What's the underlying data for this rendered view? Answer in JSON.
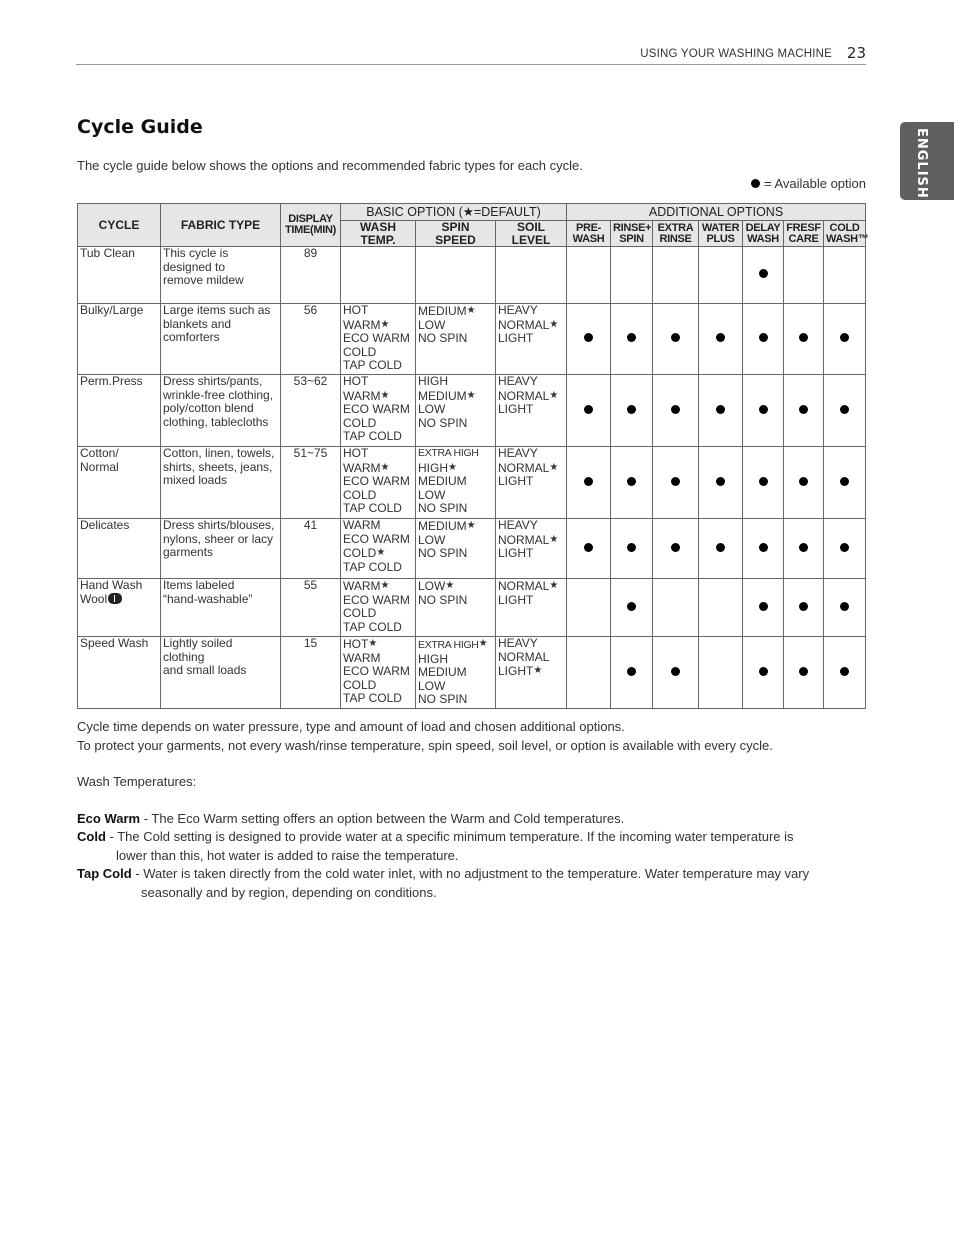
{
  "header": {
    "section": "USING YOUR WASHING MACHINE",
    "page_number": "23",
    "language_tab": "ENGLISH"
  },
  "title": "Cycle Guide",
  "intro": "The cycle guide below shows the options and recommended fabric types for each cycle.",
  "legend": {
    "icon": "filled-circle",
    "text": "= Available option"
  },
  "table": {
    "headers": {
      "cycle": "CYCLE",
      "fabric_type": "FABRIC TYPE",
      "display_time": [
        "DISPLAY",
        "TIME(MIN)"
      ],
      "basic_group": "BASIC OPTION (★=DEFAULT)",
      "basic": [
        [
          "WASH",
          "TEMP."
        ],
        [
          "SPIN",
          "SPEED"
        ],
        [
          "SOIL",
          "LEVEL"
        ]
      ],
      "additional_group": "ADDITIONAL OPTIONS",
      "additional": [
        [
          "PRE-",
          "WASH"
        ],
        [
          "RINSE+",
          "SPIN"
        ],
        [
          "EXTRA",
          "RINSE"
        ],
        [
          "WATER",
          "PLUS"
        ],
        [
          "DELAY",
          "WASH"
        ],
        [
          "FRESF",
          "CARE"
        ],
        [
          "COLD",
          "WASH™"
        ]
      ]
    },
    "default_marker": "★",
    "rows": [
      {
        "cycle": [
          "Tub Clean"
        ],
        "fabric": [
          "This cycle is",
          "designed to",
          "remove mildew"
        ],
        "time": "89",
        "wash_temp": [],
        "spin_speed": [],
        "soil_level": [],
        "options": [
          false,
          false,
          false,
          false,
          true,
          false,
          false
        ]
      },
      {
        "cycle": [
          "Bulky/Large"
        ],
        "fabric": [
          "Large items such as",
          "blankets and",
          "comforters"
        ],
        "time": "56",
        "wash_temp": [
          {
            "t": "HOT"
          },
          {
            "t": "WARM",
            "d": true
          },
          {
            "t": "ECO WARM"
          },
          {
            "t": "COLD"
          },
          {
            "t": "TAP COLD"
          }
        ],
        "spin_speed": [
          {
            "t": "MEDIUM",
            "d": true
          },
          {
            "t": "LOW"
          },
          {
            "t": "NO SPIN"
          }
        ],
        "soil_level": [
          {
            "t": "HEAVY"
          },
          {
            "t": "NORMAL",
            "d": true
          },
          {
            "t": "LIGHT"
          }
        ],
        "options": [
          true,
          true,
          true,
          true,
          true,
          true,
          true
        ]
      },
      {
        "cycle": [
          "Perm.Press"
        ],
        "fabric": [
          "Dress shirts/pants,",
          "wrinkle-free clothing,",
          "poly/cotton blend",
          "clothing, tablecloths"
        ],
        "time": "53~62",
        "wash_temp": [
          {
            "t": "HOT"
          },
          {
            "t": "WARM",
            "d": true
          },
          {
            "t": "ECO WARM"
          },
          {
            "t": "COLD"
          },
          {
            "t": "TAP COLD"
          }
        ],
        "spin_speed": [
          {
            "t": "HIGH"
          },
          {
            "t": "MEDIUM",
            "d": true
          },
          {
            "t": "LOW"
          },
          {
            "t": "NO SPIN"
          }
        ],
        "soil_level": [
          {
            "t": "HEAVY"
          },
          {
            "t": "NORMAL",
            "d": true
          },
          {
            "t": "LIGHT"
          }
        ],
        "options": [
          true,
          true,
          true,
          true,
          true,
          true,
          true
        ]
      },
      {
        "cycle": [
          "Cotton/",
          "Normal"
        ],
        "fabric": [
          "Cotton, linen, towels,",
          "shirts, sheets, jeans,",
          "mixed loads"
        ],
        "time": "51~75",
        "wash_temp": [
          {
            "t": "HOT"
          },
          {
            "t": "WARM",
            "d": true
          },
          {
            "t": "ECO WARM"
          },
          {
            "t": "COLD"
          },
          {
            "t": "TAP COLD"
          }
        ],
        "spin_speed": [
          {
            "t": "EXTRA HIGH",
            "n": true
          },
          {
            "t": "HIGH",
            "d": true
          },
          {
            "t": "MEDIUM"
          },
          {
            "t": "LOW"
          },
          {
            "t": "NO SPIN"
          }
        ],
        "soil_level": [
          {
            "t": "HEAVY"
          },
          {
            "t": "NORMAL",
            "d": true
          },
          {
            "t": "LIGHT"
          }
        ],
        "options": [
          true,
          true,
          true,
          true,
          true,
          true,
          true
        ]
      },
      {
        "cycle": [
          "Delicates"
        ],
        "fabric": [
          "Dress shirts/blouses,",
          "nylons, sheer or lacy",
          "garments"
        ],
        "time": "41",
        "wash_temp": [
          {
            "t": "WARM"
          },
          {
            "t": "ECO WARM"
          },
          {
            "t": "COLD",
            "d": true
          },
          {
            "t": "TAP COLD"
          }
        ],
        "spin_speed": [
          {
            "t": "MEDIUM",
            "d": true
          },
          {
            "t": "LOW"
          },
          {
            "t": "NO SPIN"
          }
        ],
        "soil_level": [
          {
            "t": "HEAVY"
          },
          {
            "t": "NORMAL",
            "d": true
          },
          {
            "t": "LIGHT"
          }
        ],
        "options": [
          true,
          true,
          true,
          true,
          true,
          true,
          true
        ]
      },
      {
        "cycle": [
          "Hand Wash",
          "Wool"
        ],
        "cycle_icon": "wool-mark-icon",
        "fabric": [
          "Items labeled",
          "“hand-washable”"
        ],
        "time": "55",
        "wash_temp": [
          {
            "t": "WARM",
            "d": true
          },
          {
            "t": "ECO WARM"
          },
          {
            "t": "COLD"
          },
          {
            "t": "TAP COLD"
          }
        ],
        "spin_speed": [
          {
            "t": "LOW",
            "d": true
          },
          {
            "t": "NO SPIN"
          }
        ],
        "soil_level": [
          {
            "t": "NORMAL",
            "d": true
          },
          {
            "t": "LIGHT"
          }
        ],
        "options": [
          false,
          true,
          false,
          false,
          true,
          true,
          true
        ]
      },
      {
        "cycle": [
          "Speed Wash"
        ],
        "fabric": [
          "Lightly soiled",
          "clothing",
          "and small loads"
        ],
        "time": "15",
        "wash_temp": [
          {
            "t": "HOT",
            "d": true
          },
          {
            "t": "WARM"
          },
          {
            "t": "ECO WARM"
          },
          {
            "t": "COLD"
          },
          {
            "t": "TAP COLD"
          }
        ],
        "spin_speed": [
          {
            "t": "EXTRA HIGH",
            "d": true,
            "n": true
          },
          {
            "t": "HIGH"
          },
          {
            "t": "MEDIUM"
          },
          {
            "t": "LOW"
          },
          {
            "t": "NO SPIN"
          }
        ],
        "soil_level": [
          {
            "t": "HEAVY"
          },
          {
            "t": "NORMAL"
          },
          {
            "t": "LIGHT",
            "d": true
          }
        ],
        "options": [
          false,
          true,
          true,
          false,
          true,
          true,
          true
        ]
      }
    ]
  },
  "notes": {
    "line1": "Cycle time depends on water pressure, type and amount of load and chosen additional options.",
    "line2": "To protect your garments, not every wash/rinse temperature, spin speed, soil level, or option is available with every cycle.",
    "wash_temps_heading": "Wash Temperatures:",
    "definitions": [
      {
        "term": "Eco Warm",
        "text": " - The Eco Warm setting offers an option between the Warm and Cold temperatures.",
        "cont": ""
      },
      {
        "term": "Cold",
        "text": " - The Cold setting is designed to provide water at a specific minimum temperature. If the incoming water temperature is",
        "cont": "lower than this, hot water is added to raise the temperature."
      },
      {
        "term": "Tap Cold",
        "text": " - Water is taken directly from the cold water inlet, with no adjustment to the temperature. Water temperature may vary",
        "cont": "seasonally and by region, depending on conditions."
      }
    ]
  }
}
